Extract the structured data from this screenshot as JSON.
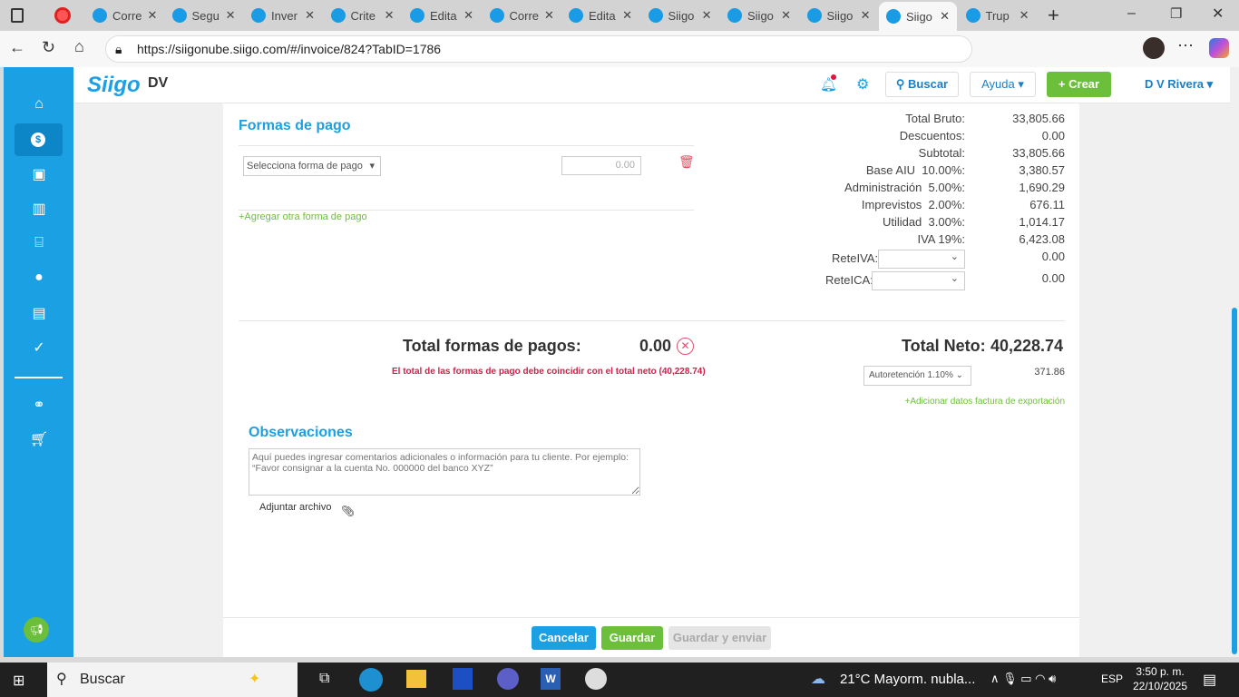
{
  "browser": {
    "tabs": [
      {
        "label": "Corre"
      },
      {
        "label": "Segu"
      },
      {
        "label": "Inver"
      },
      {
        "label": "Crite"
      },
      {
        "label": "Edita"
      },
      {
        "label": "Corre"
      },
      {
        "label": "Edita"
      },
      {
        "label": "Siigo"
      },
      {
        "label": "Siigo"
      },
      {
        "label": "Siigo"
      },
      {
        "label": "Siigo"
      },
      {
        "label": "Trup"
      }
    ],
    "url": "https://siigonube.siigo.com/#/invoice/824?TabID=1786"
  },
  "header": {
    "logo": "Siigo",
    "company": "DV",
    "search": "Buscar",
    "help": "Ayuda",
    "create": "Crear",
    "user": "D V Rivera"
  },
  "payments": {
    "title": "Formas de pago",
    "select_placeholder": "Selecciona forma de pago",
    "amount": "0.00",
    "add_link": "+Agregar otra forma de pago",
    "total_label": "Total formas de pagos:",
    "total_value": "0.00",
    "error": "El total de las formas de pago debe coincidir con el total neto (40,228.74)"
  },
  "totals": {
    "rows": [
      {
        "label": "Total Bruto:",
        "value": "33,805.66"
      },
      {
        "label": "Descuentos:",
        "value": "0.00"
      },
      {
        "label": "Subtotal:",
        "value": "33,805.66"
      },
      {
        "label": "Base AIU  10.00%:",
        "value": "3,380.57"
      },
      {
        "label": "Administración  5.00%:",
        "value": "1,690.29"
      },
      {
        "label": "Imprevistos  2.00%:",
        "value": "676.11"
      },
      {
        "label": "Utilidad  3.00%:",
        "value": "1,014.17"
      },
      {
        "label": "IVA 19%:",
        "value": "6,423.08"
      }
    ],
    "reteiva_label": "ReteIVA:",
    "reteiva_value": "0.00",
    "reteica_label": "ReteICA:",
    "reteica_value": "0.00",
    "neto_label": "Total Neto:",
    "neto_value": "40,228.74",
    "autoret": "Autoretención 1.10%",
    "autoret_value": "371.86",
    "export_link": "+Adicionar datos factura de exportación"
  },
  "observations": {
    "title": "Observaciones",
    "placeholder": "Aquí puedes ingresar comentarios adicionales o información para tu cliente. Por ejemplo: “Favor consignar a la cuenta No. 000000 del banco XYZ”",
    "attach": "Adjuntar archivo"
  },
  "footer": {
    "cancel": "Cancelar",
    "save": "Guardar",
    "save_send": "Guardar y enviar"
  },
  "taskbar": {
    "search": "Buscar",
    "weather": "21°C  Mayorm. nubla...",
    "lang": "ESP",
    "time": "3:50 p. m.",
    "date": "22/10/2025"
  }
}
